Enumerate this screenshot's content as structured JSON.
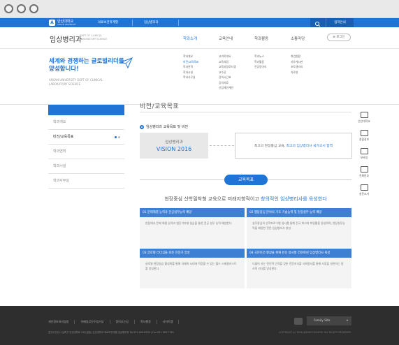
{
  "browser": {
    "controls": [
      "close",
      "minimize",
      "maximize"
    ]
  },
  "topbar": {
    "logo_text": "안산대학교",
    "logo_sub": "ANSAN UNIVERSITY",
    "select1": "의료보건학계열",
    "select2": "임상병리과",
    "login": "입학안내"
  },
  "header": {
    "dept": "임상병리과",
    "dept_en": "DEPT OF CLINICAL LABORATORY SCIENCE",
    "gnb": [
      "학과소개",
      "교육안내",
      "학과활동",
      "소통마당"
    ],
    "login_button": "로그인"
  },
  "mega": {
    "slogan": "세계와 경쟁하는 글로벌리더를 양성합니다!",
    "slogan_en": "ANSAN UNIVERSITY DEPT OF CLINICAL LABORATORY SCIENCE",
    "cols": [
      [
        "학과개요",
        "비전/교육목표",
        "학과연혁",
        "학과시설",
        "학과사무실"
      ],
      [
        "교과목개요",
        "교육과정",
        "교육과정로드맵",
        "교수진",
        "강의시간표",
        "강의자료",
        "산업체연계반"
      ],
      [
        "학과뉴스",
        "학과활동",
        "전공동아리"
      ],
      [
        "취업현황",
        "자유게시판",
        "포토갤러리",
        "자료실"
      ]
    ]
  },
  "lnb": {
    "items": [
      "학과개요",
      "비전/교육목표",
      "학과연혁",
      "학과시설",
      "학과사무실"
    ],
    "active": 1
  },
  "content": {
    "page_title": "비전/교육목표",
    "section_title": "임상병리과 교육목표 및 비전",
    "vision_label": "임상병리과",
    "vision_year": "VISION 2016",
    "vision_text_a": "최고의 현장중심 교육, ",
    "vision_text_b": "최고의 임상병리사 국가고시 합격",
    "goal_button": "교육목표",
    "goal_text_a": "현장중심 산학밀착형 교육으로 미래지향적이고 ",
    "goal_text_b": "창의적인 임상병리사를 육성한다",
    "cards": [
      {
        "title": "01 문제해결 능력과 전공실무능력 배양",
        "body": "현장에서 문제 해결 능력과 첨단기자재 실습을 통한 전공 실무 능력 배양한다."
      },
      {
        "title": "02 행동중심 분야의 기초 기술능력 및 현장실무 능력 배양",
        "body": "실무중심의 산학프로그램 실시를 통해 전국 최고의 취업률을 달성하며, 현장실무능력을 배양한 전문 임상병리사 양성"
      },
      {
        "title": "03 글로벌 리더십을 갖춘 전문가 양성",
        "body": "글로벌 현장실습 활성화를 통해 국제화 시대에 적응할 수 있는 월드 스페셜리스트를 양성한다."
      },
      {
        "title": "04 국민보건 향상을 위해 헌신 봉사할 전문화된 임상병리사 육성",
        "body": "더불어 사는 전인적 인격을 갖춘 전문지식을 사회봉사를 통해 사랑을 실천하는 봉사적 리더를 양성한다."
      }
    ]
  },
  "quick": [
    "안산대학교",
    "종합정보",
    "모바일",
    "전화번호",
    "설문조사"
  ],
  "footer": {
    "links": [
      "개인정보처리방침",
      "이메일무단수집거부",
      "찾아오는길",
      "학사행정",
      "사이트맵"
    ],
    "address": "경기도안산시 상록구 안산대학로 155(일동) 안산대학교 의료보건계열 임상병리과 Tel 031.400.6933 | Fax 031.363.7760",
    "family": "Family Site",
    "copyright": "COPYRIGHT (c) 2016 ANSAN COLLEGE. ALL RIGHTS RESERVED."
  }
}
